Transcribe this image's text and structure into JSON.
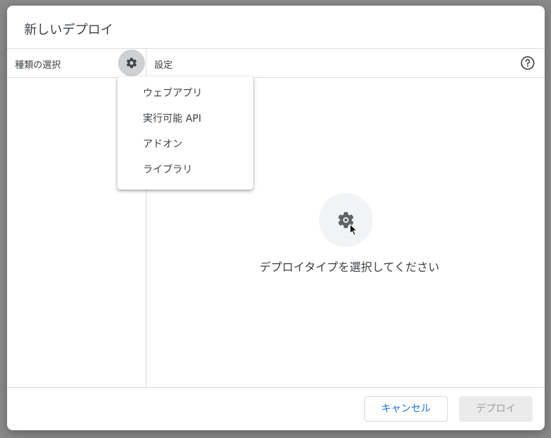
{
  "dialog": {
    "title": "新しいデプロイ",
    "left_panel": {
      "label": "種類の選択"
    },
    "right_panel": {
      "label": "設定"
    },
    "menu": {
      "items": [
        {
          "label": "ウェブアプリ"
        },
        {
          "label": "実行可能 API"
        },
        {
          "label": "アドオン"
        },
        {
          "label": "ライブラリ"
        }
      ]
    },
    "empty_state": {
      "message": "デプロイタイプを選択してください"
    },
    "footer": {
      "cancel_label": "キャンセル",
      "deploy_label": "デプロイ"
    }
  },
  "icons": {
    "settings": "gear-icon",
    "help": "help-icon",
    "empty": "gear-icon",
    "pointer": "mouse-cursor"
  },
  "colors": {
    "primary_text": "#3c4043",
    "accent": "#1a73e8",
    "disabled_text": "#9aa0a6",
    "backdrop": "#8a8a8a"
  }
}
